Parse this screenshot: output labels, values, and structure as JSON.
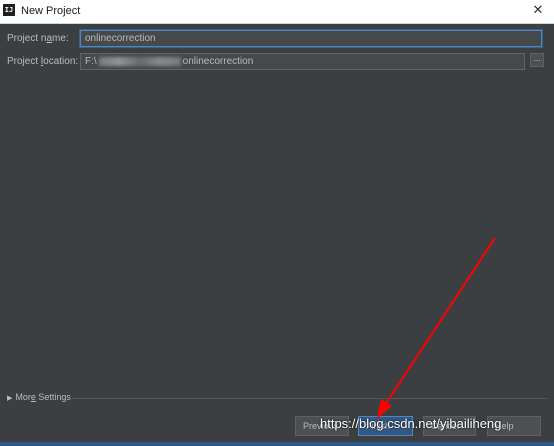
{
  "window": {
    "icon_text": "IJ",
    "title": "New Project",
    "close_glyph": "✕"
  },
  "form": {
    "name_label_pre": "Project n",
    "name_label_key": "a",
    "name_label_post": "me:",
    "name_value": "onlinecorrection",
    "location_label_pre": "Project ",
    "location_label_key": "l",
    "location_label_post": "ocation:",
    "location_prefix": "F:\\",
    "location_suffix": "onlinecorrection",
    "browse_label": "..."
  },
  "more_settings": {
    "label_pre": "Mor",
    "label_key": "e",
    "label_post": " Settings",
    "toggle_icon": "triangle-right-icon"
  },
  "buttons": {
    "previous": "Previous",
    "finish": "Finish",
    "cancel": "Cancel",
    "help": "Help"
  },
  "overlay": {
    "watermark": "https://blog.csdn.net/yibailiheng",
    "arrow_color": "#ff0000"
  },
  "colors": {
    "background": "#3c3f41",
    "focus_border": "#4a88c7",
    "text": "#bbbbbb"
  }
}
